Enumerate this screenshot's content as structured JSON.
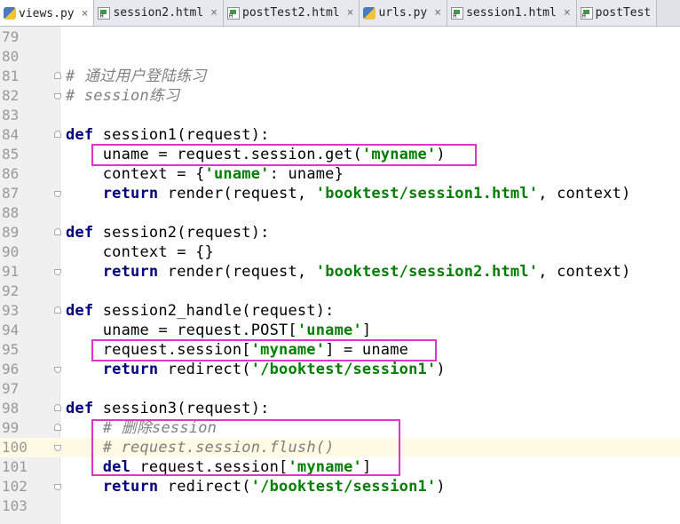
{
  "tabs": [
    {
      "label": "views.py",
      "type": "py",
      "active": true,
      "closable": true
    },
    {
      "label": "session2.html",
      "type": "html",
      "active": false,
      "closable": true
    },
    {
      "label": "postTest2.html",
      "type": "html",
      "active": false,
      "closable": true
    },
    {
      "label": "urls.py",
      "type": "py",
      "active": false,
      "closable": true
    },
    {
      "label": "session1.html",
      "type": "html",
      "active": false,
      "closable": true
    },
    {
      "label": "postTest",
      "type": "html",
      "active": false,
      "closable": false
    }
  ],
  "close_glyph": "×",
  "current_line": "100",
  "lines": [
    {
      "n": "79",
      "tokens": []
    },
    {
      "n": "80",
      "tokens": []
    },
    {
      "n": "81",
      "fold": "start",
      "tokens": [
        {
          "t": "# 通过用户登陆练习",
          "c": "cm"
        }
      ]
    },
    {
      "n": "82",
      "fold": "end",
      "tokens": [
        {
          "t": "# session练习",
          "c": "cm"
        }
      ]
    },
    {
      "n": "83",
      "tokens": []
    },
    {
      "n": "84",
      "fold": "start",
      "tokens": [
        {
          "t": "def",
          "c": "kw"
        },
        {
          "t": " session1(request):"
        }
      ]
    },
    {
      "n": "85",
      "tokens": [
        {
          "t": "    uname = request.session.get("
        },
        {
          "t": "'myname'",
          "c": "str"
        },
        {
          "t": ")"
        }
      ]
    },
    {
      "n": "86",
      "tokens": [
        {
          "t": "    context = {"
        },
        {
          "t": "'uname'",
          "c": "str"
        },
        {
          "t": ": uname}"
        }
      ]
    },
    {
      "n": "87",
      "fold": "end",
      "tokens": [
        {
          "t": "    "
        },
        {
          "t": "return",
          "c": "kw"
        },
        {
          "t": " render(request, "
        },
        {
          "t": "'booktest/session1.html'",
          "c": "str"
        },
        {
          "t": ", context)"
        }
      ]
    },
    {
      "n": "88",
      "tokens": []
    },
    {
      "n": "89",
      "fold": "start",
      "tokens": [
        {
          "t": "def",
          "c": "kw"
        },
        {
          "t": " session2(request):"
        }
      ]
    },
    {
      "n": "90",
      "tokens": [
        {
          "t": "    context = {}"
        }
      ]
    },
    {
      "n": "91",
      "fold": "end",
      "tokens": [
        {
          "t": "    "
        },
        {
          "t": "return",
          "c": "kw"
        },
        {
          "t": " render(request, "
        },
        {
          "t": "'booktest/session2.html'",
          "c": "str"
        },
        {
          "t": ", context)"
        }
      ]
    },
    {
      "n": "92",
      "tokens": []
    },
    {
      "n": "93",
      "fold": "start",
      "tokens": [
        {
          "t": "def",
          "c": "kw"
        },
        {
          "t": " session2_handle(request):"
        }
      ]
    },
    {
      "n": "94",
      "tokens": [
        {
          "t": "    uname = request.POST["
        },
        {
          "t": "'uname'",
          "c": "str"
        },
        {
          "t": "]"
        }
      ]
    },
    {
      "n": "95",
      "tokens": [
        {
          "t": "    request.session["
        },
        {
          "t": "'myname'",
          "c": "str"
        },
        {
          "t": "] = uname"
        }
      ]
    },
    {
      "n": "96",
      "fold": "end",
      "tokens": [
        {
          "t": "    "
        },
        {
          "t": "return",
          "c": "kw"
        },
        {
          "t": " redirect("
        },
        {
          "t": "'/booktest/session1'",
          "c": "str"
        },
        {
          "t": ")"
        }
      ]
    },
    {
      "n": "97",
      "tokens": []
    },
    {
      "n": "98",
      "fold": "start",
      "tokens": [
        {
          "t": "def",
          "c": "kw"
        },
        {
          "t": " session3(request):"
        }
      ]
    },
    {
      "n": "99",
      "fold": "start",
      "tokens": [
        {
          "t": "    "
        },
        {
          "t": "# 删除session",
          "c": "cm"
        }
      ]
    },
    {
      "n": "100",
      "fold": "end",
      "tokens": [
        {
          "t": "    "
        },
        {
          "t": "# request.session.flush()",
          "c": "cm"
        }
      ]
    },
    {
      "n": "101",
      "tokens": [
        {
          "t": "    "
        },
        {
          "t": "del",
          "c": "kw"
        },
        {
          "t": " request.session["
        },
        {
          "t": "'myname'",
          "c": "str"
        },
        {
          "t": "]"
        }
      ]
    },
    {
      "n": "102",
      "fold": "end",
      "tokens": [
        {
          "t": "    "
        },
        {
          "t": "return",
          "c": "kw"
        },
        {
          "t": " redirect("
        },
        {
          "t": "'/booktest/session1'",
          "c": "str"
        },
        {
          "t": ")"
        }
      ]
    },
    {
      "n": "103",
      "tokens": []
    }
  ],
  "annotation_color": "#e033d0"
}
